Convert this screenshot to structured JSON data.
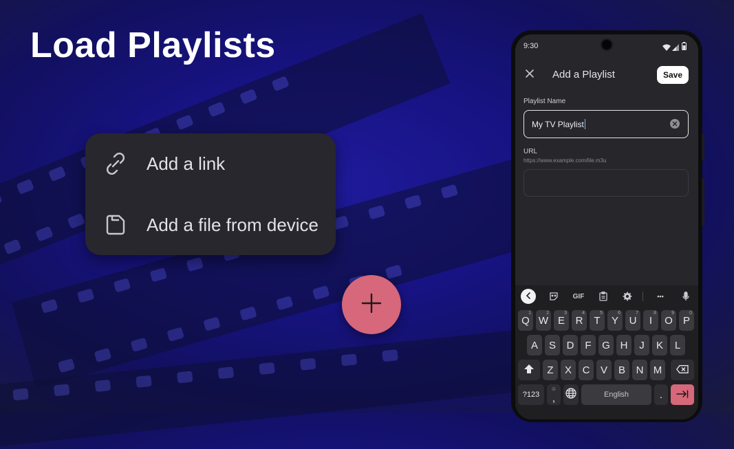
{
  "headline": "Load Playlists",
  "menu": {
    "items": [
      {
        "label": "Add a link",
        "icon": "link-icon"
      },
      {
        "label": "Add a file from device",
        "icon": "file-icon"
      }
    ]
  },
  "fab": {
    "icon": "plus-icon"
  },
  "phone": {
    "status": {
      "time": "9:30"
    },
    "appbar": {
      "title": "Add a Playlist",
      "save_label": "Save"
    },
    "playlist_name": {
      "label": "Playlist Name",
      "value": "My TV Playlist"
    },
    "url": {
      "label": "URL",
      "hint": "https://www.example.com/lile.m3u",
      "value": ""
    },
    "keyboard": {
      "toolbar": {
        "gif_label": "GIF",
        "more_label": "•••"
      },
      "row1": [
        {
          "key": "Q",
          "num": "1"
        },
        {
          "key": "W",
          "num": "2"
        },
        {
          "key": "E",
          "num": "3"
        },
        {
          "key": "R",
          "num": "4"
        },
        {
          "key": "T",
          "num": "5"
        },
        {
          "key": "Y",
          "num": "6"
        },
        {
          "key": "U",
          "num": "7"
        },
        {
          "key": "I",
          "num": "8"
        },
        {
          "key": "O",
          "num": "9"
        },
        {
          "key": "P",
          "num": "0"
        }
      ],
      "row2": [
        "A",
        "S",
        "D",
        "F",
        "G",
        "H",
        "J",
        "K",
        "L"
      ],
      "row3": [
        "Z",
        "X",
        "C",
        "V",
        "B",
        "N",
        "M"
      ],
      "symbols_label": "?123",
      "comma_label": ",",
      "emoji_label": "☺",
      "space_label": "English",
      "period_label": "."
    }
  },
  "colors": {
    "fab": "#d7677a",
    "enter_key": "#d7677a",
    "card": "#27272d",
    "background": "#171383"
  }
}
